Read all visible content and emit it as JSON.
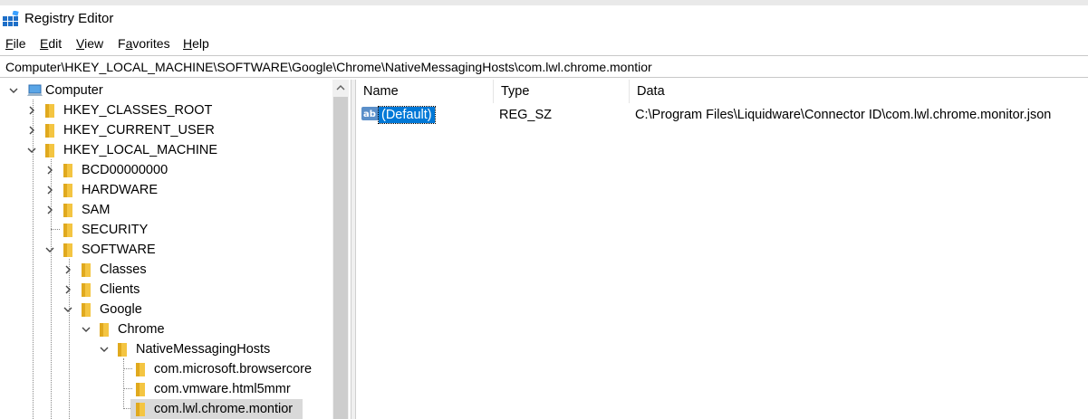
{
  "window": {
    "title": "Registry Editor"
  },
  "menu": [
    {
      "key": "F",
      "rest": "ile"
    },
    {
      "key": "E",
      "rest": "dit"
    },
    {
      "key": "V",
      "rest": "iew"
    },
    {
      "key": "a",
      "pre": "F",
      "rest": "vorites"
    },
    {
      "key": "H",
      "rest": "elp"
    }
  ],
  "address": {
    "path": "Computer\\HKEY_LOCAL_MACHINE\\SOFTWARE\\Google\\Chrome\\NativeMessagingHosts\\com.lwl.chrome.montior"
  },
  "tree": {
    "root": "Computer",
    "items": [
      {
        "label": "HKEY_CLASSES_ROOT",
        "state": "collapsed"
      },
      {
        "label": "HKEY_CURRENT_USER",
        "state": "collapsed"
      },
      {
        "label": "HKEY_LOCAL_MACHINE",
        "state": "expanded"
      },
      {
        "label": "BCD00000000",
        "state": "collapsed"
      },
      {
        "label": "HARDWARE",
        "state": "collapsed"
      },
      {
        "label": "SAM",
        "state": "collapsed"
      },
      {
        "label": "SECURITY",
        "state": "leaf"
      },
      {
        "label": "SOFTWARE",
        "state": "expanded"
      },
      {
        "label": "Classes",
        "state": "collapsed"
      },
      {
        "label": "Clients",
        "state": "collapsed"
      },
      {
        "label": "Google",
        "state": "expanded"
      },
      {
        "label": "Chrome",
        "state": "expanded"
      },
      {
        "label": "NativeMessagingHosts",
        "state": "expanded"
      },
      {
        "label": "com.microsoft.browsercore",
        "state": "leaf"
      },
      {
        "label": "com.vmware.html5mmr",
        "state": "leaf"
      },
      {
        "label": "com.lwl.chrome.montior",
        "state": "leaf",
        "selected": true
      }
    ]
  },
  "list": {
    "columns": [
      "Name",
      "Type",
      "Data"
    ],
    "rows": [
      {
        "icon": "string-value-icon",
        "name": "(Default)",
        "type": "REG_SZ",
        "data": "C:\\Program Files\\Liquidware\\Connector ID\\com.lwl.chrome.monitor.json",
        "selected": true
      }
    ]
  },
  "colors": {
    "selection": "#0078d7",
    "folder": "#f4c542",
    "tree_selection": "#d9d9d9"
  }
}
